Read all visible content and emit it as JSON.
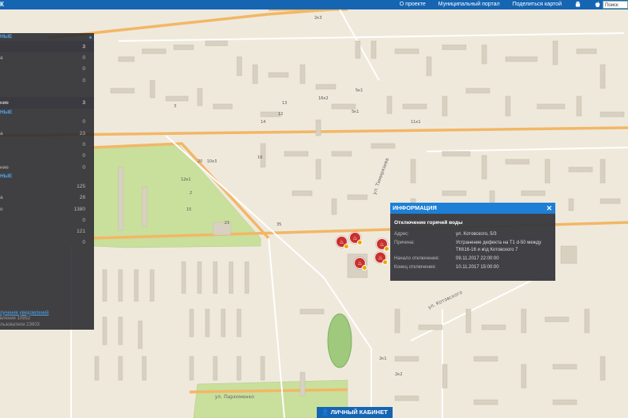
{
  "topbar": {
    "brand": "К",
    "nav": [
      "О проекте",
      "Муниципальный портал",
      "Поделиться картой"
    ],
    "search_placeholder": "Поиск",
    "icons": [
      "android-icon",
      "apple-icon"
    ]
  },
  "sidebar": {
    "sections": [
      {
        "header": "НЫЕ",
        "rows": [
          {
            "label": "",
            "value": "3",
            "highlight": true
          },
          {
            "label": "а",
            "value": "0"
          },
          {
            "label": "",
            "value": "0"
          },
          {
            "label": "",
            "value": "0"
          },
          {
            "label": "",
            "value": "",
            "blank": true
          },
          {
            "label": "ние",
            "value": "3",
            "highlight": true
          }
        ]
      },
      {
        "header": "НЫЕ",
        "rows": [
          {
            "label": "",
            "value": "0"
          },
          {
            "label": "а",
            "value": "23"
          },
          {
            "label": "",
            "value": "0"
          },
          {
            "label": "",
            "value": "0"
          },
          {
            "label": "ние",
            "value": "0"
          }
        ]
      },
      {
        "header": "НЫЕ",
        "rows": [
          {
            "label": "",
            "value": "125"
          },
          {
            "label": "а",
            "value": "28"
          },
          {
            "label": "о",
            "value": "1380"
          },
          {
            "label": "",
            "value": "0"
          },
          {
            "label": "",
            "value": "121"
          },
          {
            "label": "",
            "value": "0"
          }
        ]
      }
    ],
    "footer": {
      "link": "лучение уведомлений",
      "line1": "вления 10952",
      "line2": "льзователи 23603"
    }
  },
  "popup": {
    "header": "ИНФОРМАЦИЯ",
    "close": "✕",
    "title": "Отключение горячей воды",
    "rows": [
      {
        "k": "Адрес:",
        "v": "ул. Котовского, 5/3"
      },
      {
        "k": "Причина:",
        "v": "Устранение дефекта на Т1 d-50 между ТК616-16 и ж\\д Котовского 7"
      },
      {
        "k": "Начало отключения:",
        "v": "09.11.2017 22:00:00"
      },
      {
        "k": "Конец отключения:",
        "v": "10.11.2017 15:00:00"
      }
    ]
  },
  "cabinet": {
    "label": "ЛИЧНЫЙ КАБИНЕТ"
  },
  "map_labels": {
    "streets": [
      "ул. Тимирязева",
      "ул. Пархоменко",
      "ул. Котовского"
    ],
    "houses": [
      "2к3",
      "5к1",
      "10к3",
      "11к1",
      "13",
      "23",
      "12к1",
      "2",
      "20",
      "35",
      "16к2",
      "12",
      "14",
      "16",
      "15",
      "5к1",
      "2к1",
      "2к2",
      "3"
    ]
  },
  "colors": {
    "accent": "#1565b3",
    "popup_header": "#1d7fd6",
    "marker": "#c9302c",
    "park": "#c6df9a",
    "road_major": "#f5c778"
  }
}
